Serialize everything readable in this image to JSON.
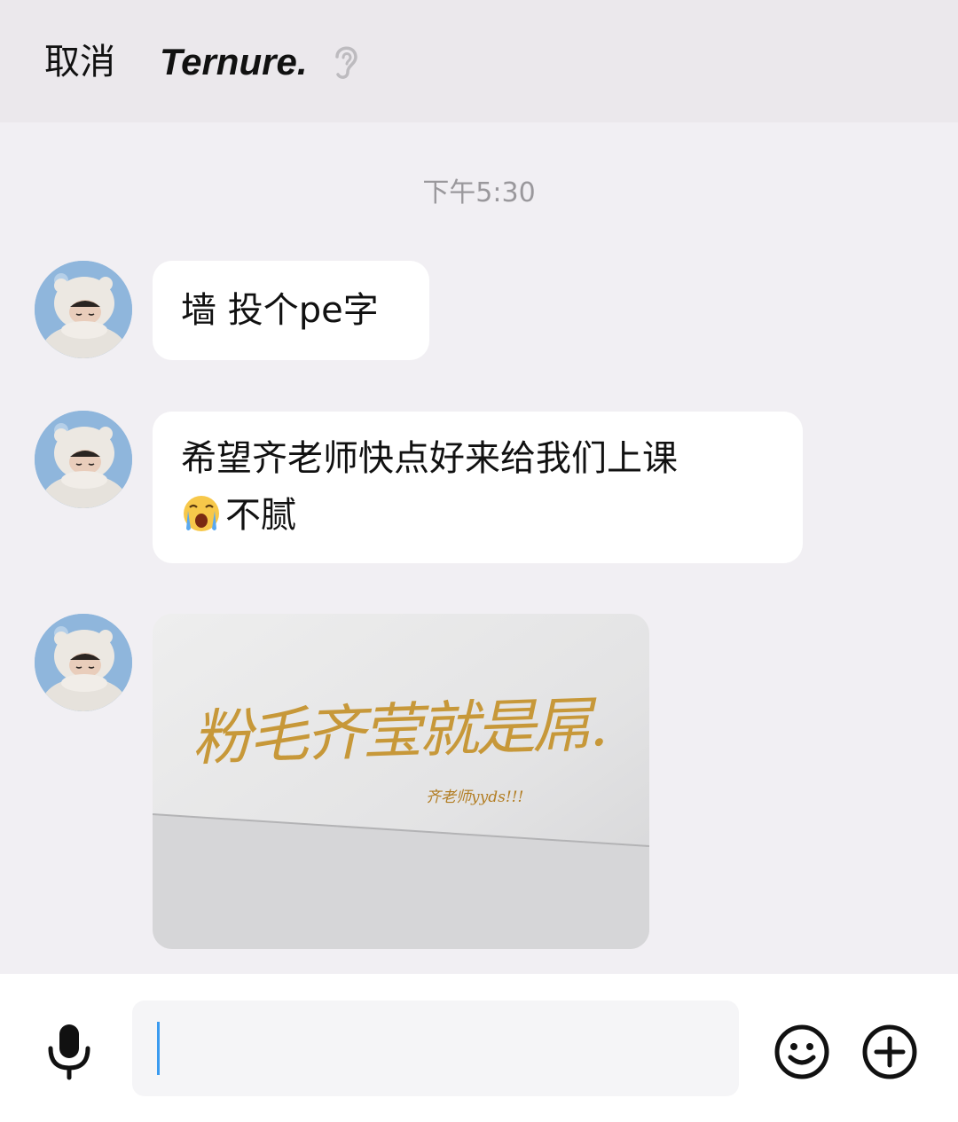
{
  "header": {
    "cancel_label": "取消",
    "title": "Ternure."
  },
  "chat": {
    "timestamp": "下午5:30",
    "messages": [
      {
        "type": "text",
        "lines": [
          "墙 投个pe字"
        ]
      },
      {
        "type": "text",
        "lines": [
          "希望齐老师快点好来给我们上课",
          "不腻"
        ],
        "emoji": "loudly-crying-face"
      },
      {
        "type": "image",
        "image_text": "粉毛齐莹就是屌.",
        "image_subtext": "齐老师yyds!!!"
      }
    ]
  },
  "composer": {
    "input_value": "",
    "icons": [
      "microphone-icon",
      "smiley-icon",
      "plus-circle-icon"
    ]
  },
  "colors": {
    "background": "#f1eff3",
    "header_bg": "#ebe8ec",
    "bubble_bg": "#ffffff",
    "timestamp": "#9a989c",
    "caret": "#3a9bf0",
    "handwriting": "#c5922b"
  }
}
